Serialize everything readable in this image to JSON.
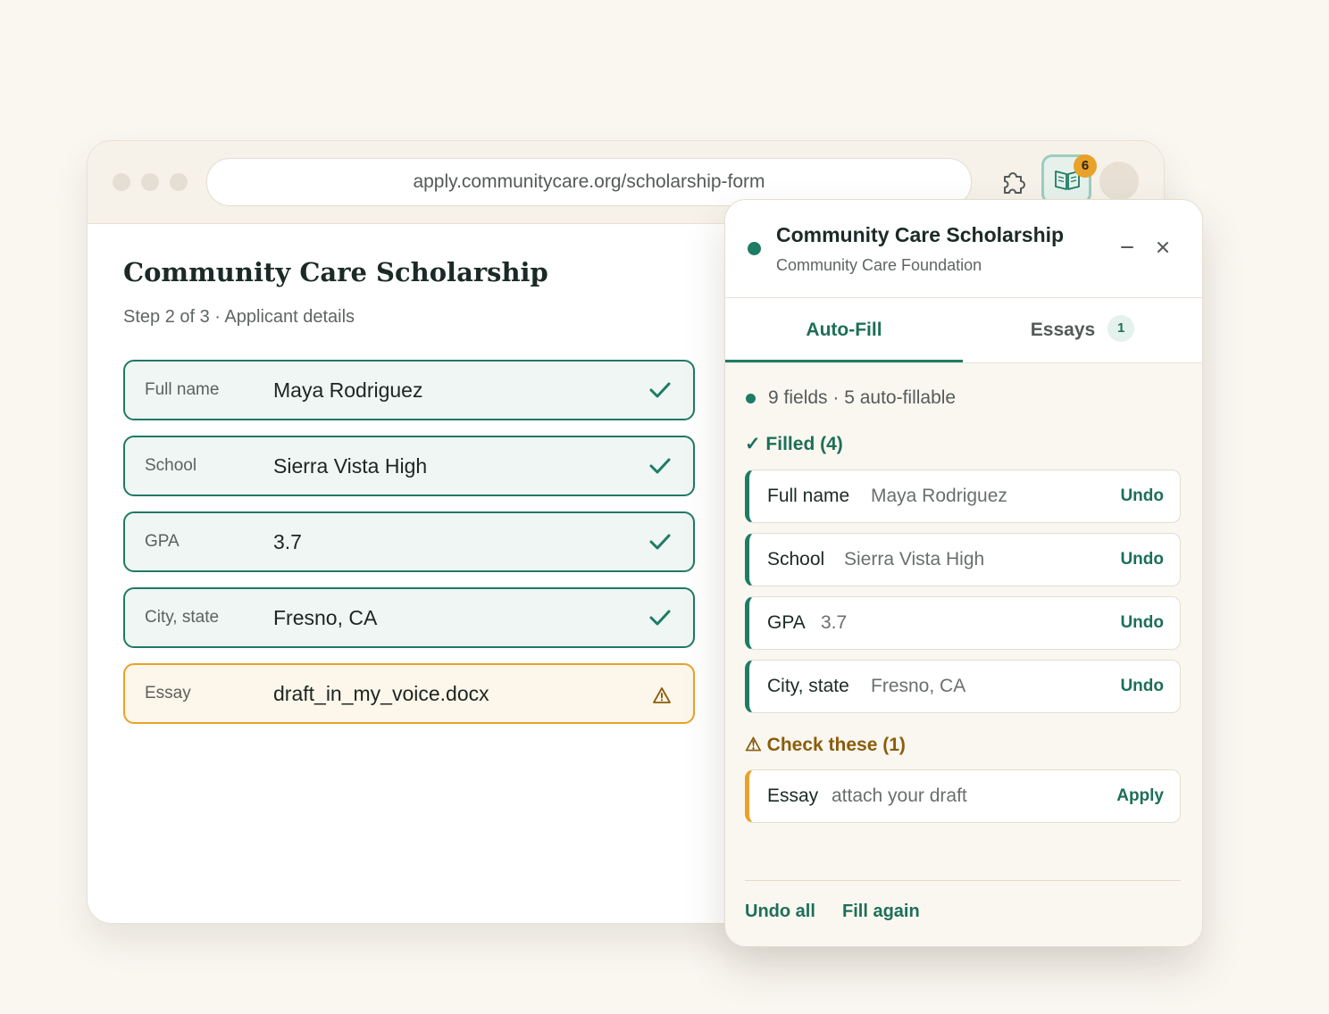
{
  "browser": {
    "url": "apply.communitycare.org/scholarship-form",
    "extension_badge": "6"
  },
  "form": {
    "title": "Community Care Scholarship",
    "subtitle": "Step 2 of 3 · Applicant details",
    "fields": [
      {
        "label": "Full name",
        "value": "Maya Rodriguez",
        "status": "filled"
      },
      {
        "label": "School",
        "value": "Sierra Vista High",
        "status": "filled"
      },
      {
        "label": "GPA",
        "value": "3.7",
        "status": "filled"
      },
      {
        "label": "City, state",
        "value": "Fresno, CA",
        "status": "filled"
      },
      {
        "label": "Essay",
        "value": "draft_in_my_voice.docx",
        "status": "warning"
      }
    ]
  },
  "panel": {
    "title": "Community Care Scholarship",
    "org": "Community Care Foundation",
    "tabs": [
      {
        "label": "Auto-Fill"
      },
      {
        "label": "Essays",
        "count": "1"
      }
    ],
    "summary": "9 fields · 5 auto-fillable",
    "filled_heading": "✓ Filled (4)",
    "filled_rows": [
      {
        "label": "Full name",
        "value": "Maya Rodriguez",
        "action": "Undo"
      },
      {
        "label": "School",
        "value": "Sierra Vista High",
        "action": "Undo"
      },
      {
        "label": "GPA",
        "value": "3.7",
        "action": "Undo"
      },
      {
        "label": "City, state",
        "value": "Fresno, CA",
        "action": "Undo"
      }
    ],
    "check_heading": "⚠ Check these (1)",
    "check_rows": [
      {
        "label": "Essay",
        "value": "attach your draft",
        "action": "Apply"
      }
    ],
    "footer": {
      "undo_all": "Undo all",
      "fill_again": "Fill again"
    }
  },
  "colors": {
    "accent": "#1d7c63",
    "warning": "#e9a229",
    "background": "#faf7f1"
  }
}
